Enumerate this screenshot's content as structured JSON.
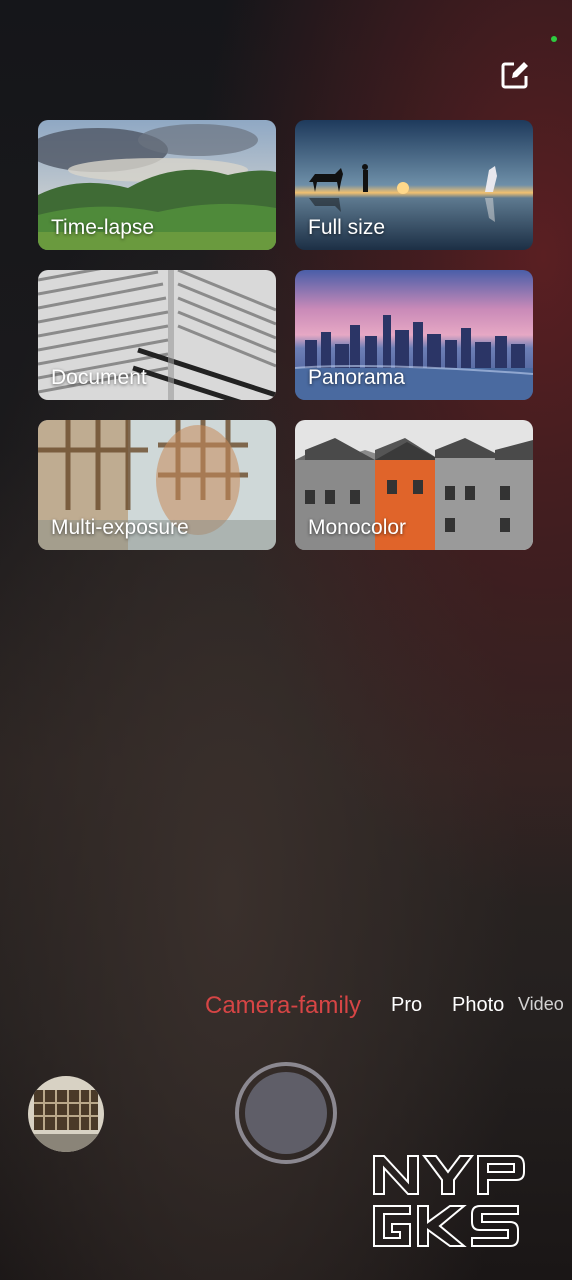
{
  "toolbar": {
    "edit_icon": "edit-square-icon"
  },
  "tiles": [
    {
      "label": "Time-lapse",
      "image": "green-hills-cloudy-sky"
    },
    {
      "label": "Full size",
      "image": "sunset-horse-silhouettes"
    },
    {
      "label": "Document",
      "image": "printed-text-page"
    },
    {
      "label": "Panorama",
      "image": "city-skyline-dusk"
    },
    {
      "label": "Multi-exposure",
      "image": "double-exposure-face-window"
    },
    {
      "label": "Monocolor",
      "image": "gray-houses-orange-house"
    }
  ],
  "modes": [
    {
      "label": "Camera-family",
      "active": true
    },
    {
      "label": "Pro",
      "active": false
    },
    {
      "label": "Photo",
      "active": false
    },
    {
      "label": "Video",
      "active": false
    }
  ],
  "watermark": {
    "line1": "NYP",
    "line2": "GKS"
  },
  "colors": {
    "active_mode": "#d64545",
    "status_dot": "#2ecc40",
    "shutter_ring": "#8b8890"
  }
}
